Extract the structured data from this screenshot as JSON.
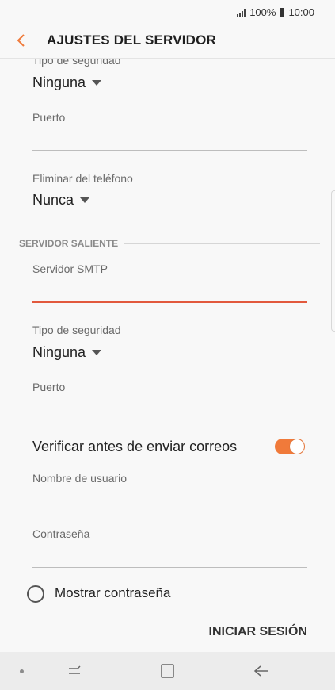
{
  "status_bar": {
    "battery": "100%",
    "time": "10:00",
    "signal_icon": "signal-bars-icon",
    "battery_icon": "battery-icon"
  },
  "header": {
    "title": "AJUSTES DEL SERVIDOR",
    "back_icon": "chevron-left-icon"
  },
  "incoming": {
    "security_label": "Tipo de seguridad",
    "security_value": "Ninguna",
    "port_label": "Puerto",
    "port_value": "",
    "delete_label": "Eliminar del teléfono",
    "delete_value": "Nunca"
  },
  "outgoing": {
    "section_title": "SERVIDOR SALIENTE",
    "smtp_label": "Servidor SMTP",
    "smtp_value": "",
    "security_label": "Tipo de seguridad",
    "security_value": "Ninguna",
    "port_label": "Puerto",
    "port_value": "",
    "verify_label": "Verificar antes de enviar correos",
    "verify_enabled": true,
    "username_label": "Nombre de usuario",
    "username_value": "",
    "password_label": "Contraseña",
    "password_value": "",
    "show_password_label": "Mostrar contraseña",
    "show_password_checked": false
  },
  "footer": {
    "login_label": "INICIAR SESIÓN"
  },
  "colors": {
    "accent": "#f07a3a",
    "active_underline": "#e2593d"
  },
  "nav_bar": {
    "items": [
      "dot-icon",
      "recent-apps-icon",
      "home-icon",
      "back-arrow-icon"
    ]
  }
}
